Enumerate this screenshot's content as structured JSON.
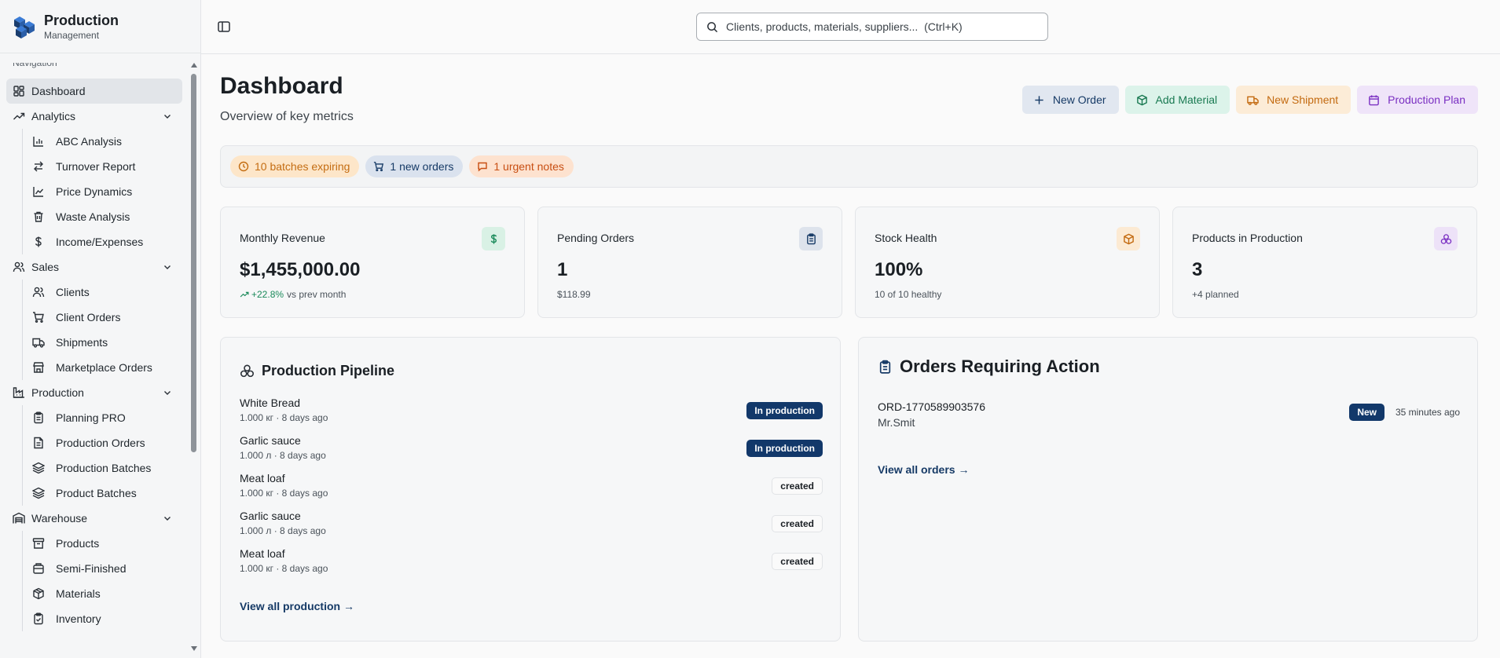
{
  "brand": {
    "title": "Production",
    "subtitle": "Management"
  },
  "sidebar": {
    "caption": "Navigation",
    "dashboard": "Dashboard",
    "groups": {
      "analytics": {
        "label": "Analytics",
        "items": [
          "ABC Analysis",
          "Turnover Report",
          "Price Dynamics",
          "Waste Analysis",
          "Income/Expenses"
        ]
      },
      "sales": {
        "label": "Sales",
        "items": [
          "Clients",
          "Client Orders",
          "Shipments",
          "Marketplace Orders"
        ]
      },
      "production": {
        "label": "Production",
        "items": [
          "Planning PRO",
          "Production Orders",
          "Production Batches",
          "Product Batches"
        ]
      },
      "warehouse": {
        "label": "Warehouse",
        "items": [
          "Products",
          "Semi-Finished",
          "Materials",
          "Inventory"
        ]
      }
    }
  },
  "search": {
    "placeholder": "Clients, products, materials, suppliers...  (Ctrl+K)"
  },
  "page": {
    "title": "Dashboard",
    "subtitle": "Overview of key metrics"
  },
  "actions": {
    "new_order": "New Order",
    "add_material": "Add Material",
    "new_shipment": "New Shipment",
    "production_plan": "Production Plan"
  },
  "alerts": {
    "expiring": "10 batches expiring",
    "new_orders": "1 new orders",
    "urgent_notes": "1 urgent notes"
  },
  "stats": {
    "revenue": {
      "label": "Monthly Revenue",
      "value": "$1,455,000.00",
      "trend": "+22.8%",
      "note": "vs prev month"
    },
    "pending": {
      "label": "Pending Orders",
      "value": "1",
      "note": "$118.99"
    },
    "stock": {
      "label": "Stock Health",
      "value": "100%",
      "note": "10 of 10 healthy"
    },
    "production": {
      "label": "Products in Production",
      "value": "3",
      "note": "+4 planned"
    }
  },
  "pipeline": {
    "title": "Production Pipeline",
    "rows": [
      {
        "name": "White Bread",
        "meta": "1.000 кг · 8 days ago",
        "status": "In production"
      },
      {
        "name": "Garlic sauce",
        "meta": "1.000 л · 8 days ago",
        "status": "In production"
      },
      {
        "name": "Meat loaf",
        "meta": "1.000 кг · 8 days ago",
        "status": "created"
      },
      {
        "name": "Garlic sauce",
        "meta": "1.000 л · 8 days ago",
        "status": "created"
      },
      {
        "name": "Meat loaf",
        "meta": "1.000 кг · 8 days ago",
        "status": "created"
      }
    ],
    "view_all": "View all production →"
  },
  "orders": {
    "title": "Orders Requiring Action",
    "rows": [
      {
        "id": "ORD-1770589903576",
        "client": "Mr.Smit",
        "status": "New",
        "time": "35 minutes ago"
      }
    ],
    "view_all": "View all orders →"
  },
  "colors": {
    "primary": "#12386a",
    "green": "#1a7a52",
    "orange": "#c36a10",
    "purple": "#7a2fc2"
  }
}
